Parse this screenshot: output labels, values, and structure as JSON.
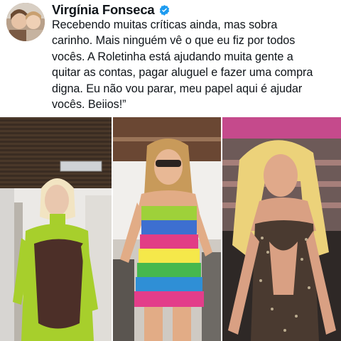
{
  "post": {
    "author_name": "Virgínia Fonseca",
    "verified_icon": "verified-badge-icon",
    "text": "Recebendo muitas críticas ainda, mas sobra\ncarinho. Mais ninguém vê o que eu fiz por todos\nvocês. A Roletinha está ajudando muita gente a\nquitar as contas, pagar aluguel e fazer uma compra\ndigna. Eu não vou parar, meu papel aqui é ajudar\nvocês. Beiios!”"
  },
  "colors": {
    "text": "#0f1419",
    "verified": "#1d9bf0"
  }
}
